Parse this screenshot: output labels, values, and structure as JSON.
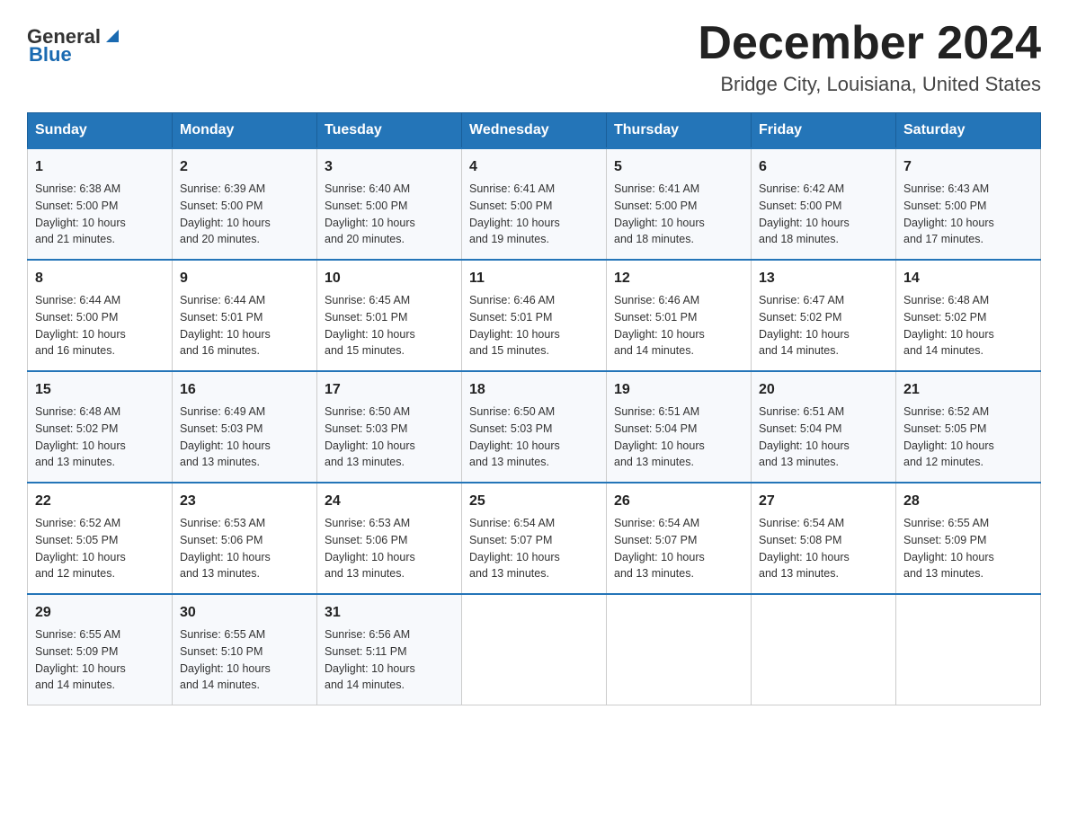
{
  "header": {
    "logo_general": "General",
    "logo_blue": "Blue",
    "month_title": "December 2024",
    "location": "Bridge City, Louisiana, United States"
  },
  "weekdays": [
    "Sunday",
    "Monday",
    "Tuesday",
    "Wednesday",
    "Thursday",
    "Friday",
    "Saturday"
  ],
  "weeks": [
    [
      {
        "day": "1",
        "sunrise": "6:38 AM",
        "sunset": "5:00 PM",
        "daylight": "10 hours and 21 minutes."
      },
      {
        "day": "2",
        "sunrise": "6:39 AM",
        "sunset": "5:00 PM",
        "daylight": "10 hours and 20 minutes."
      },
      {
        "day": "3",
        "sunrise": "6:40 AM",
        "sunset": "5:00 PM",
        "daylight": "10 hours and 20 minutes."
      },
      {
        "day": "4",
        "sunrise": "6:41 AM",
        "sunset": "5:00 PM",
        "daylight": "10 hours and 19 minutes."
      },
      {
        "day": "5",
        "sunrise": "6:41 AM",
        "sunset": "5:00 PM",
        "daylight": "10 hours and 18 minutes."
      },
      {
        "day": "6",
        "sunrise": "6:42 AM",
        "sunset": "5:00 PM",
        "daylight": "10 hours and 18 minutes."
      },
      {
        "day": "7",
        "sunrise": "6:43 AM",
        "sunset": "5:00 PM",
        "daylight": "10 hours and 17 minutes."
      }
    ],
    [
      {
        "day": "8",
        "sunrise": "6:44 AM",
        "sunset": "5:00 PM",
        "daylight": "10 hours and 16 minutes."
      },
      {
        "day": "9",
        "sunrise": "6:44 AM",
        "sunset": "5:01 PM",
        "daylight": "10 hours and 16 minutes."
      },
      {
        "day": "10",
        "sunrise": "6:45 AM",
        "sunset": "5:01 PM",
        "daylight": "10 hours and 15 minutes."
      },
      {
        "day": "11",
        "sunrise": "6:46 AM",
        "sunset": "5:01 PM",
        "daylight": "10 hours and 15 minutes."
      },
      {
        "day": "12",
        "sunrise": "6:46 AM",
        "sunset": "5:01 PM",
        "daylight": "10 hours and 14 minutes."
      },
      {
        "day": "13",
        "sunrise": "6:47 AM",
        "sunset": "5:02 PM",
        "daylight": "10 hours and 14 minutes."
      },
      {
        "day": "14",
        "sunrise": "6:48 AM",
        "sunset": "5:02 PM",
        "daylight": "10 hours and 14 minutes."
      }
    ],
    [
      {
        "day": "15",
        "sunrise": "6:48 AM",
        "sunset": "5:02 PM",
        "daylight": "10 hours and 13 minutes."
      },
      {
        "day": "16",
        "sunrise": "6:49 AM",
        "sunset": "5:03 PM",
        "daylight": "10 hours and 13 minutes."
      },
      {
        "day": "17",
        "sunrise": "6:50 AM",
        "sunset": "5:03 PM",
        "daylight": "10 hours and 13 minutes."
      },
      {
        "day": "18",
        "sunrise": "6:50 AM",
        "sunset": "5:03 PM",
        "daylight": "10 hours and 13 minutes."
      },
      {
        "day": "19",
        "sunrise": "6:51 AM",
        "sunset": "5:04 PM",
        "daylight": "10 hours and 13 minutes."
      },
      {
        "day": "20",
        "sunrise": "6:51 AM",
        "sunset": "5:04 PM",
        "daylight": "10 hours and 13 minutes."
      },
      {
        "day": "21",
        "sunrise": "6:52 AM",
        "sunset": "5:05 PM",
        "daylight": "10 hours and 12 minutes."
      }
    ],
    [
      {
        "day": "22",
        "sunrise": "6:52 AM",
        "sunset": "5:05 PM",
        "daylight": "10 hours and 12 minutes."
      },
      {
        "day": "23",
        "sunrise": "6:53 AM",
        "sunset": "5:06 PM",
        "daylight": "10 hours and 13 minutes."
      },
      {
        "day": "24",
        "sunrise": "6:53 AM",
        "sunset": "5:06 PM",
        "daylight": "10 hours and 13 minutes."
      },
      {
        "day": "25",
        "sunrise": "6:54 AM",
        "sunset": "5:07 PM",
        "daylight": "10 hours and 13 minutes."
      },
      {
        "day": "26",
        "sunrise": "6:54 AM",
        "sunset": "5:07 PM",
        "daylight": "10 hours and 13 minutes."
      },
      {
        "day": "27",
        "sunrise": "6:54 AM",
        "sunset": "5:08 PM",
        "daylight": "10 hours and 13 minutes."
      },
      {
        "day": "28",
        "sunrise": "6:55 AM",
        "sunset": "5:09 PM",
        "daylight": "10 hours and 13 minutes."
      }
    ],
    [
      {
        "day": "29",
        "sunrise": "6:55 AM",
        "sunset": "5:09 PM",
        "daylight": "10 hours and 14 minutes."
      },
      {
        "day": "30",
        "sunrise": "6:55 AM",
        "sunset": "5:10 PM",
        "daylight": "10 hours and 14 minutes."
      },
      {
        "day": "31",
        "sunrise": "6:56 AM",
        "sunset": "5:11 PM",
        "daylight": "10 hours and 14 minutes."
      },
      null,
      null,
      null,
      null
    ]
  ],
  "labels": {
    "sunrise": "Sunrise:",
    "sunset": "Sunset:",
    "daylight": "Daylight:"
  }
}
